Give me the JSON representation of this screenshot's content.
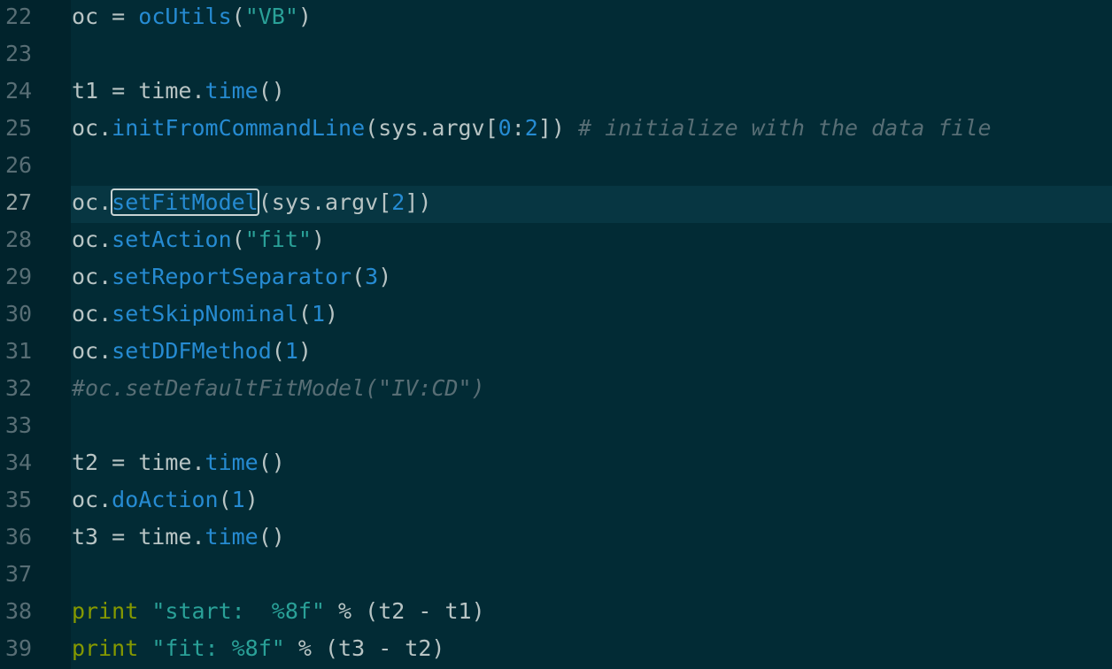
{
  "editor": {
    "current_line": "27",
    "lines": [
      {
        "num": "22",
        "tokens": [
          {
            "t": "oc = ",
            "c": "plain"
          },
          {
            "t": "ocUtils",
            "c": "func"
          },
          {
            "t": "(",
            "c": "plain"
          },
          {
            "t": "\"VB\"",
            "c": "str"
          },
          {
            "t": ")",
            "c": "plain"
          }
        ]
      },
      {
        "num": "23",
        "tokens": []
      },
      {
        "num": "24",
        "tokens": [
          {
            "t": "t1 = time.",
            "c": "plain"
          },
          {
            "t": "time",
            "c": "func"
          },
          {
            "t": "()",
            "c": "plain"
          }
        ]
      },
      {
        "num": "25",
        "tokens": [
          {
            "t": "oc.",
            "c": "plain"
          },
          {
            "t": "initFromCommandLine",
            "c": "func"
          },
          {
            "t": "(sys.argv[",
            "c": "plain"
          },
          {
            "t": "0",
            "c": "num"
          },
          {
            "t": ":",
            "c": "plain"
          },
          {
            "t": "2",
            "c": "num"
          },
          {
            "t": "]) ",
            "c": "plain"
          },
          {
            "t": "# initialize with the data file",
            "c": "com"
          }
        ]
      },
      {
        "num": "26",
        "tokens": []
      },
      {
        "num": "27",
        "tokens": [
          {
            "t": "oc.",
            "c": "plain"
          },
          {
            "t": "setFitModel",
            "c": "hl"
          },
          {
            "t": "(sys.argv[",
            "c": "plain"
          },
          {
            "t": "2",
            "c": "num"
          },
          {
            "t": "])",
            "c": "plain"
          }
        ]
      },
      {
        "num": "28",
        "tokens": [
          {
            "t": "oc.",
            "c": "plain"
          },
          {
            "t": "setAction",
            "c": "func"
          },
          {
            "t": "(",
            "c": "plain"
          },
          {
            "t": "\"fit\"",
            "c": "str"
          },
          {
            "t": ")",
            "c": "plain"
          }
        ]
      },
      {
        "num": "29",
        "tokens": [
          {
            "t": "oc.",
            "c": "plain"
          },
          {
            "t": "setReportSeparator",
            "c": "func"
          },
          {
            "t": "(",
            "c": "plain"
          },
          {
            "t": "3",
            "c": "num"
          },
          {
            "t": ")",
            "c": "plain"
          }
        ]
      },
      {
        "num": "30",
        "tokens": [
          {
            "t": "oc.",
            "c": "plain"
          },
          {
            "t": "setSkipNominal",
            "c": "func"
          },
          {
            "t": "(",
            "c": "plain"
          },
          {
            "t": "1",
            "c": "num"
          },
          {
            "t": ")",
            "c": "plain"
          }
        ]
      },
      {
        "num": "31",
        "tokens": [
          {
            "t": "oc.",
            "c": "plain"
          },
          {
            "t": "setDDFMethod",
            "c": "func"
          },
          {
            "t": "(",
            "c": "plain"
          },
          {
            "t": "1",
            "c": "num"
          },
          {
            "t": ")",
            "c": "plain"
          }
        ]
      },
      {
        "num": "32",
        "tokens": [
          {
            "t": "#oc.setDefaultFitModel(\"IV:CD\")",
            "c": "com"
          }
        ]
      },
      {
        "num": "33",
        "tokens": []
      },
      {
        "num": "34",
        "tokens": [
          {
            "t": "t2 = time.",
            "c": "plain"
          },
          {
            "t": "time",
            "c": "func"
          },
          {
            "t": "()",
            "c": "plain"
          }
        ]
      },
      {
        "num": "35",
        "tokens": [
          {
            "t": "oc.",
            "c": "plain"
          },
          {
            "t": "doAction",
            "c": "func"
          },
          {
            "t": "(",
            "c": "plain"
          },
          {
            "t": "1",
            "c": "num"
          },
          {
            "t": ")",
            "c": "plain"
          }
        ]
      },
      {
        "num": "36",
        "tokens": [
          {
            "t": "t3 = time.",
            "c": "plain"
          },
          {
            "t": "time",
            "c": "func"
          },
          {
            "t": "()",
            "c": "plain"
          }
        ]
      },
      {
        "num": "37",
        "tokens": []
      },
      {
        "num": "38",
        "tokens": [
          {
            "t": "print",
            "c": "kw"
          },
          {
            "t": " ",
            "c": "plain"
          },
          {
            "t": "\"start:  %8f\"",
            "c": "str"
          },
          {
            "t": " % (t2 - t1)",
            "c": "plain"
          }
        ]
      },
      {
        "num": "39",
        "tokens": [
          {
            "t": "print",
            "c": "kw"
          },
          {
            "t": " ",
            "c": "plain"
          },
          {
            "t": "\"fit: %8f\"",
            "c": "str"
          },
          {
            "t": " % (t3 - t2)",
            "c": "plain"
          }
        ]
      }
    ]
  }
}
